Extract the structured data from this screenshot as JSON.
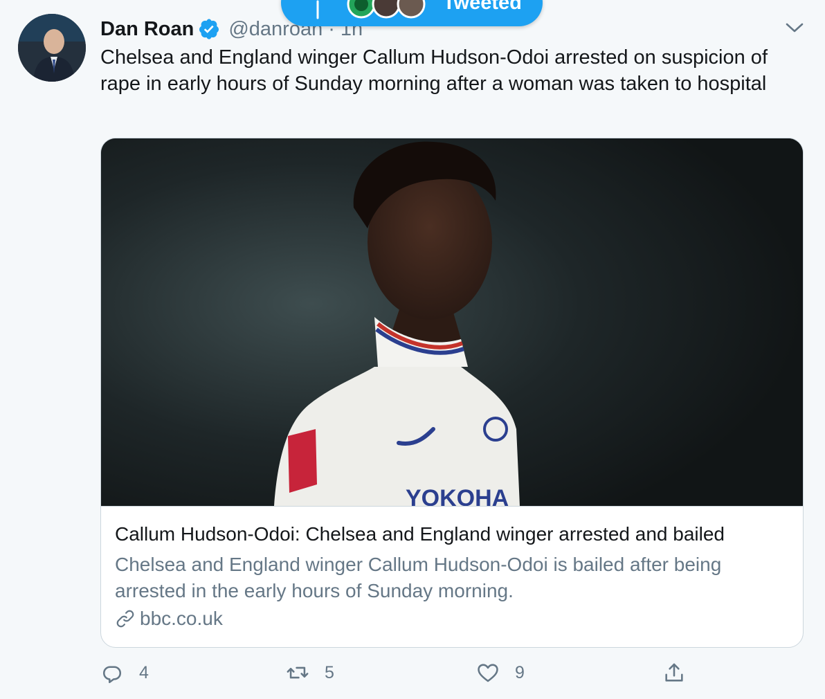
{
  "banner": {
    "label": "Tweeted"
  },
  "tweet": {
    "author_name": "Dan Roan",
    "handle": "@danroan",
    "separator": "·",
    "time": "1h",
    "text": "Chelsea and England winger Callum Hudson-Odoi arrested on suspicion of rape in early hours of Sunday morning after a woman was taken to hospital",
    "verified": true
  },
  "card": {
    "title": "Callum Hudson-Odoi: Chelsea and England winger arrested and bailed",
    "description": "Chelsea and England winger Callum Hudson-Odoi is bailed after being arrested in the early hours of Sunday morning.",
    "domain": "bbc.co.uk"
  },
  "actions": {
    "reply_count": "4",
    "retweet_count": "5",
    "like_count": "9"
  },
  "colors": {
    "accent": "#1da1f2",
    "secondary_text": "#657786",
    "primary_text": "#14171a",
    "background": "#f5f8fa",
    "border": "#ccd6dd"
  },
  "icons": [
    "verified-badge-icon",
    "chevron-down-icon",
    "reply-icon",
    "retweet-icon",
    "like-icon",
    "share-icon",
    "link-icon",
    "arrow-up-icon"
  ]
}
